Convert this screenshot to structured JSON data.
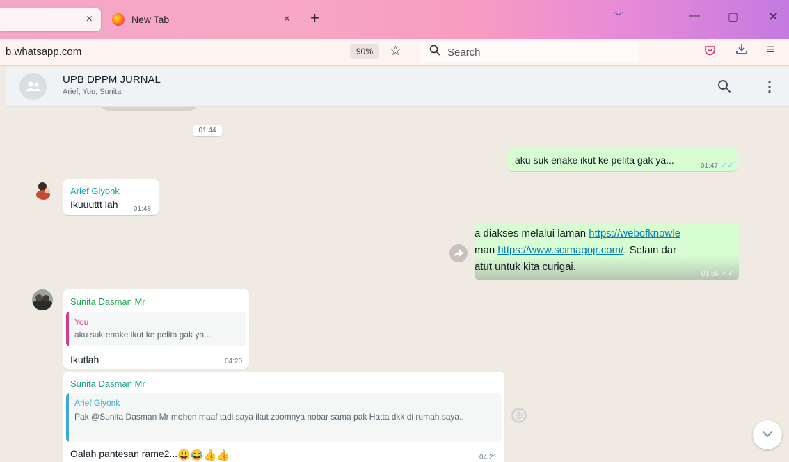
{
  "browser": {
    "tabs": [
      {
        "label": "",
        "close": "×"
      },
      {
        "label": "New Tab",
        "close": "×"
      }
    ],
    "new_tab_glyph": "+",
    "tab_list_glyph": "﹀",
    "window_controls": {
      "minimize": "—",
      "maximize": "▢",
      "close": "✕"
    },
    "url": "b.whatsapp.com",
    "zoom": "90%",
    "search_placeholder": "Search",
    "accent_color": "#2a5bd7"
  },
  "chat": {
    "group_name": "UPB DPPM JURNAL",
    "members": "Arief, You, Sunita",
    "date_chip": "01:44",
    "messages": [
      {
        "type": "out",
        "text": "aku suk enake ikut ke pelita gak ya...",
        "time": "01:47",
        "ticks": "✓✓"
      },
      {
        "type": "in",
        "sender": "Arief Giyonk",
        "text": "Ikuuuttt lah",
        "time": "01:48"
      },
      {
        "type": "out",
        "line1": "a diakses melalui laman ",
        "link1": "https://webofknowle",
        "line2": "man ",
        "link2": "https://www.scimagojr.com/",
        "line2_tail": ". Selain dar",
        "line3": "atut untuk kita curigai.",
        "time": "01:56",
        "ticks": "✓✓"
      },
      {
        "type": "in",
        "sender": "Sunita Dasman Mr",
        "quote_name": "You",
        "quote_text": "aku suk enake ikut ke pelita gak ya...",
        "text": "Ikutlah",
        "time": "04:20"
      },
      {
        "type": "in",
        "sender": "Sunita Dasman Mr",
        "quote_name": "Arief Giyonk",
        "quote_text": "Pak @Sunita Dasman Mr  mohon maaf tadi saya ikut zoomnya nobar sama pak Hatta dkk di rumah saya..",
        "text": "Oalah pantesan rame2...",
        "emoji": "😃😂👍👍",
        "time": "04:21"
      }
    ]
  },
  "colors": {
    "chat_bg": "#efeae2",
    "outgoing_bubble": "#d9fdd3",
    "incoming_bubble": "#ffffff",
    "sender_arief": "#06a1b8",
    "sender_sunita": "#1fa855",
    "quote_you": "#cf3e8f",
    "quote_arief": "#3fa9d6",
    "read_ticks": "#53bdeb"
  },
  "icons": {
    "tab_favicon": "firefox-icon",
    "bookmark": "star-icon",
    "search": "search-icon",
    "pocket": "pocket-icon",
    "downloads": "download-icon",
    "menu": "hamburger-icon",
    "group_avatar": "group-icon",
    "chat_search": "search-icon",
    "chat_menu": "kebab-icon",
    "forward": "forward-icon",
    "react": "emoji-icon",
    "scroll": "chevron-down-icon"
  }
}
